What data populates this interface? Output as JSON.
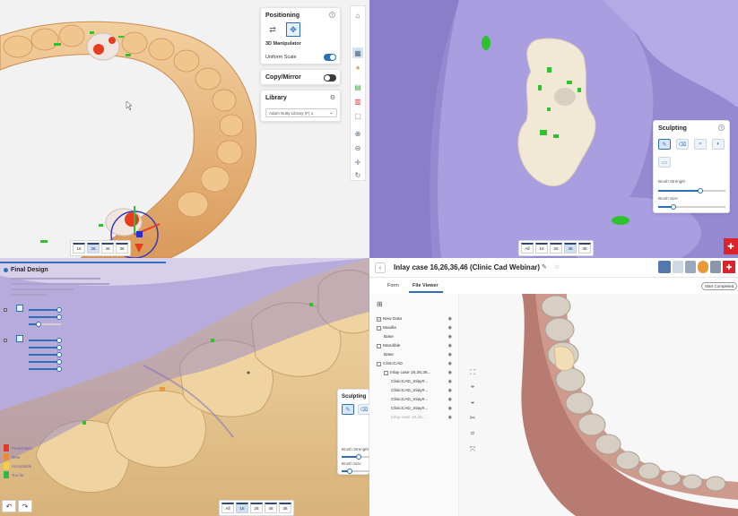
{
  "q1": {
    "positioning": {
      "title": "Positioning",
      "help": "?",
      "manipulator_label": "3D Manipulator",
      "uniform_scale_label": "Uniform Scale"
    },
    "copy_mirror_label": "Copy/Mirror",
    "library": {
      "title": "Library",
      "selected": "Adam Nutty Library (F) 1"
    },
    "view_buttons": [
      "16",
      "26",
      "46",
      "36"
    ]
  },
  "q2": {
    "sculpting": {
      "title": "Sculpting",
      "help": "?",
      "brush_strength_label": "Brush Strength",
      "brush_strength": 0.62,
      "brush_size_label": "Brush Size",
      "brush_size": 0.22
    },
    "view_buttons": [
      "All",
      "16",
      "26",
      "46",
      "36"
    ]
  },
  "q3": {
    "final_design": {
      "title": "Final Design"
    },
    "legend": [
      "Penetration",
      "Near",
      "Acceptable",
      "Too far"
    ],
    "sculpting": {
      "title": "Sculpting",
      "brush_strength_label": "Brush Strength",
      "brush_strength": 0.6,
      "brush_size_label": "Brush Size",
      "brush_size": 0.28
    },
    "view_buttons": [
      "All",
      "16",
      "26",
      "46",
      "36"
    ]
  },
  "q4": {
    "title": "Inlay case 16,26,36,46 (Clinic Cad Webinar)",
    "tabs": [
      "Form",
      "File Viewer"
    ],
    "start_button": "Start Completed",
    "tree": [
      {
        "label": "New Data",
        "level": 0,
        "exp": "+"
      },
      {
        "label": "Maxilla",
        "level": 0,
        "exp": "-"
      },
      {
        "label": "Base",
        "level": 1,
        "exp": ""
      },
      {
        "label": "Mandible",
        "level": 0,
        "exp": "-"
      },
      {
        "label": "Base",
        "level": 1,
        "exp": ""
      },
      {
        "label": "ClinicCAD",
        "level": 0,
        "exp": "-"
      },
      {
        "label": "Inlay case 16,26,36...",
        "level": 1,
        "exp": "-"
      },
      {
        "label": "ClinicCAD_Inlay#...",
        "level": 2,
        "exp": ""
      },
      {
        "label": "ClinicCAD_Inlay#...",
        "level": 2,
        "exp": ""
      },
      {
        "label": "ClinicCAD_Inlay#...",
        "level": 2,
        "exp": ""
      },
      {
        "label": "ClinicCAD_Inlay#...",
        "level": 2,
        "exp": ""
      },
      {
        "label": "Inlay case 16,26...",
        "level": 2,
        "exp": ""
      }
    ]
  },
  "colors": {
    "accent": "#2d6fb8",
    "tooth": "#e8b57c",
    "gum_purple": "#9a8fd6",
    "margin_green": "#2ec22e"
  }
}
